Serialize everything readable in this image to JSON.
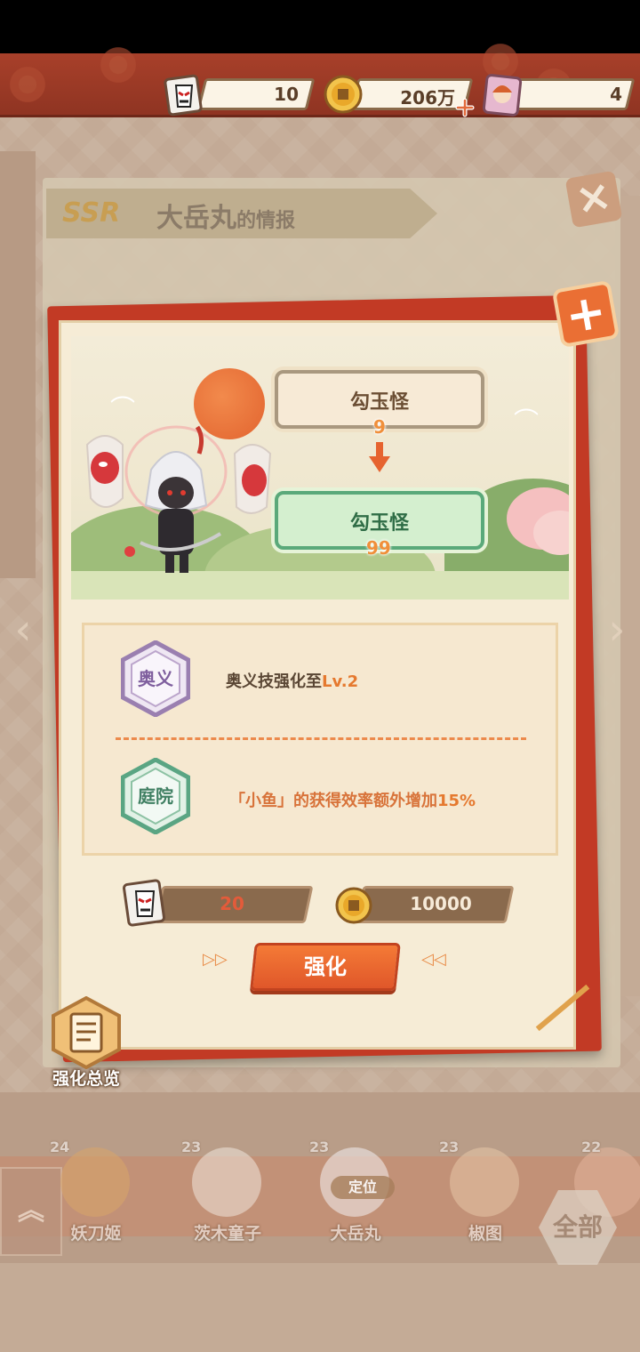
{
  "resources": {
    "ticket_count": "10",
    "coins": "206万",
    "tokens": "4"
  },
  "background": {
    "rarity": "SSR",
    "title_name": "大岳丸",
    "title_suffix": "的情报"
  },
  "evolution": {
    "from": {
      "name": "勾玉怪",
      "level": "9"
    },
    "to": {
      "name": "勾玉怪",
      "level": "99"
    }
  },
  "effects": [
    {
      "tag": "奥义",
      "text": "奥义技强化至",
      "highlight": "Lv.2"
    },
    {
      "tag": "庭院",
      "text": "「小鱼」的获得效率额外增加",
      "highlight": "15%"
    }
  ],
  "cost": {
    "tickets": "20",
    "coins": "10000"
  },
  "buttons": {
    "upgrade": "强化",
    "overview": "强化总览",
    "all": "全部",
    "locate": "定位"
  },
  "shelf": [
    {
      "name": "妖刀姬",
      "level": "24"
    },
    {
      "name": "茨木童子",
      "level": "23"
    },
    {
      "name": "大岳丸",
      "level": "23"
    },
    {
      "name": "椒图",
      "level": "23"
    },
    {
      "name": "",
      "level": "22"
    }
  ],
  "colors": {
    "accent": "#e5792f",
    "dialog_border": "#c23a25",
    "button": "#f47a36"
  }
}
